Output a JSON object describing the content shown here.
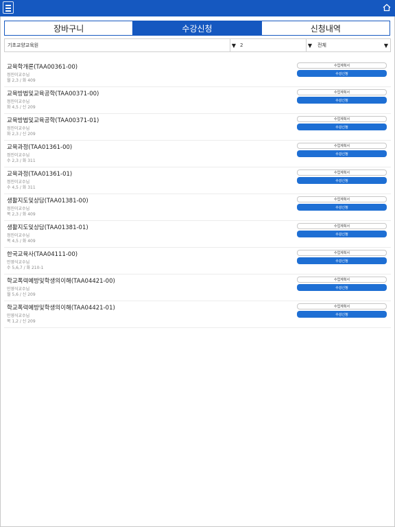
{
  "header": {
    "menu_icon": "hamburger-menu-icon",
    "home_icon": "home-icon",
    "color": "#1558c0"
  },
  "tabs": [
    {
      "label": "장바구니",
      "active": false
    },
    {
      "label": "수강신청",
      "active": true
    },
    {
      "label": "신청내역",
      "active": false
    }
  ],
  "filters": {
    "department": "기초교양교육원",
    "grade": "2",
    "type": "전체"
  },
  "courses": [
    {
      "title": "교육학개론(TAA00361-00)",
      "professor": "정진이교수님",
      "time": "월 2,3 / 화 409",
      "plan_label": "수업계획서",
      "apply_label": "수강신청"
    },
    {
      "title": "교육방법및교육공학(TAA00371-00)",
      "professor": "정진이교수님",
      "time": "화 4,5 / 신 209",
      "plan_label": "수업계획서",
      "apply_label": "수강신청"
    },
    {
      "title": "교육방법및교육공학(TAA00371-01)",
      "professor": "정진이교수님",
      "time": "화 2,3 / 신 209",
      "plan_label": "수업계획서",
      "apply_label": "수강신청"
    },
    {
      "title": "교육과정(TAA01361-00)",
      "professor": "정진이교수님",
      "time": "수 2,3 / 화 311",
      "plan_label": "수업계획서",
      "apply_label": "수강신청"
    },
    {
      "title": "교육과정(TAA01361-01)",
      "professor": "정진이교수님",
      "time": "수 4,5 / 화 311",
      "plan_label": "수업계획서",
      "apply_label": "수강신청"
    },
    {
      "title": "생활지도및상담(TAA01381-00)",
      "professor": "정진이교수님",
      "time": "목 2,3 / 화 409",
      "plan_label": "수업계획서",
      "apply_label": "수강신청"
    },
    {
      "title": "생활지도및상담(TAA01381-01)",
      "professor": "정진이교수님",
      "time": "목 4,5 / 화 409",
      "plan_label": "수업계획서",
      "apply_label": "수강신청"
    },
    {
      "title": "한국교육사(TAA04111-00)",
      "professor": "민영식교수님",
      "time": "수 5,6,7 / 화 210-1",
      "plan_label": "수업계획서",
      "apply_label": "수강신청"
    },
    {
      "title": "학교폭력예방및학생의이해(TAA04421-00)",
      "professor": "민영식교수님",
      "time": "월 5,6 / 신 209",
      "plan_label": "수업계획서",
      "apply_label": "수강신청"
    },
    {
      "title": "학교폭력예방및학생의이해(TAA04421-01)",
      "professor": "민영식교수님",
      "time": "목 1,2 / 신 209",
      "plan_label": "수업계획서",
      "apply_label": "수강신청"
    }
  ]
}
